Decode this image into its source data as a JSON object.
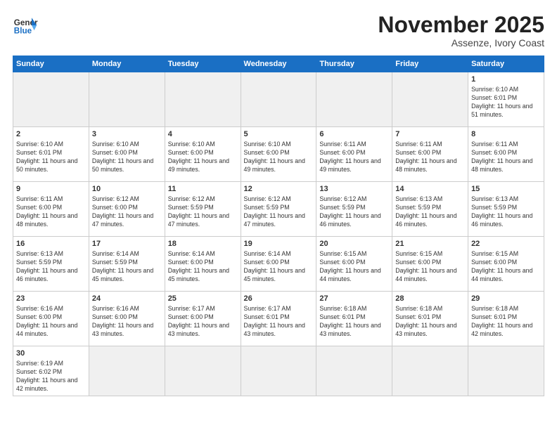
{
  "logo": {
    "text_general": "General",
    "text_blue": "Blue"
  },
  "title": "November 2025",
  "subtitle": "Assenze, Ivory Coast",
  "days_of_week": [
    "Sunday",
    "Monday",
    "Tuesday",
    "Wednesday",
    "Thursday",
    "Friday",
    "Saturday"
  ],
  "weeks": [
    [
      {
        "day": "",
        "empty": true
      },
      {
        "day": "",
        "empty": true
      },
      {
        "day": "",
        "empty": true
      },
      {
        "day": "",
        "empty": true
      },
      {
        "day": "",
        "empty": true
      },
      {
        "day": "",
        "empty": true
      },
      {
        "day": "1",
        "sunrise": "6:10 AM",
        "sunset": "6:01 PM",
        "daylight": "11 hours and 51 minutes."
      }
    ],
    [
      {
        "day": "2",
        "sunrise": "6:10 AM",
        "sunset": "6:01 PM",
        "daylight": "11 hours and 50 minutes."
      },
      {
        "day": "3",
        "sunrise": "6:10 AM",
        "sunset": "6:00 PM",
        "daylight": "11 hours and 50 minutes."
      },
      {
        "day": "4",
        "sunrise": "6:10 AM",
        "sunset": "6:00 PM",
        "daylight": "11 hours and 49 minutes."
      },
      {
        "day": "5",
        "sunrise": "6:10 AM",
        "sunset": "6:00 PM",
        "daylight": "11 hours and 49 minutes."
      },
      {
        "day": "6",
        "sunrise": "6:11 AM",
        "sunset": "6:00 PM",
        "daylight": "11 hours and 49 minutes."
      },
      {
        "day": "7",
        "sunrise": "6:11 AM",
        "sunset": "6:00 PM",
        "daylight": "11 hours and 48 minutes."
      },
      {
        "day": "8",
        "sunrise": "6:11 AM",
        "sunset": "6:00 PM",
        "daylight": "11 hours and 48 minutes."
      }
    ],
    [
      {
        "day": "9",
        "sunrise": "6:11 AM",
        "sunset": "6:00 PM",
        "daylight": "11 hours and 48 minutes."
      },
      {
        "day": "10",
        "sunrise": "6:12 AM",
        "sunset": "6:00 PM",
        "daylight": "11 hours and 47 minutes."
      },
      {
        "day": "11",
        "sunrise": "6:12 AM",
        "sunset": "5:59 PM",
        "daylight": "11 hours and 47 minutes."
      },
      {
        "day": "12",
        "sunrise": "6:12 AM",
        "sunset": "5:59 PM",
        "daylight": "11 hours and 47 minutes."
      },
      {
        "day": "13",
        "sunrise": "6:12 AM",
        "sunset": "5:59 PM",
        "daylight": "11 hours and 46 minutes."
      },
      {
        "day": "14",
        "sunrise": "6:13 AM",
        "sunset": "5:59 PM",
        "daylight": "11 hours and 46 minutes."
      },
      {
        "day": "15",
        "sunrise": "6:13 AM",
        "sunset": "5:59 PM",
        "daylight": "11 hours and 46 minutes."
      }
    ],
    [
      {
        "day": "16",
        "sunrise": "6:13 AM",
        "sunset": "5:59 PM",
        "daylight": "11 hours and 46 minutes."
      },
      {
        "day": "17",
        "sunrise": "6:14 AM",
        "sunset": "5:59 PM",
        "daylight": "11 hours and 45 minutes."
      },
      {
        "day": "18",
        "sunrise": "6:14 AM",
        "sunset": "6:00 PM",
        "daylight": "11 hours and 45 minutes."
      },
      {
        "day": "19",
        "sunrise": "6:14 AM",
        "sunset": "6:00 PM",
        "daylight": "11 hours and 45 minutes."
      },
      {
        "day": "20",
        "sunrise": "6:15 AM",
        "sunset": "6:00 PM",
        "daylight": "11 hours and 44 minutes."
      },
      {
        "day": "21",
        "sunrise": "6:15 AM",
        "sunset": "6:00 PM",
        "daylight": "11 hours and 44 minutes."
      },
      {
        "day": "22",
        "sunrise": "6:15 AM",
        "sunset": "6:00 PM",
        "daylight": "11 hours and 44 minutes."
      }
    ],
    [
      {
        "day": "23",
        "sunrise": "6:16 AM",
        "sunset": "6:00 PM",
        "daylight": "11 hours and 44 minutes."
      },
      {
        "day": "24",
        "sunrise": "6:16 AM",
        "sunset": "6:00 PM",
        "daylight": "11 hours and 43 minutes."
      },
      {
        "day": "25",
        "sunrise": "6:17 AM",
        "sunset": "6:00 PM",
        "daylight": "11 hours and 43 minutes."
      },
      {
        "day": "26",
        "sunrise": "6:17 AM",
        "sunset": "6:01 PM",
        "daylight": "11 hours and 43 minutes."
      },
      {
        "day": "27",
        "sunrise": "6:18 AM",
        "sunset": "6:01 PM",
        "daylight": "11 hours and 43 minutes."
      },
      {
        "day": "28",
        "sunrise": "6:18 AM",
        "sunset": "6:01 PM",
        "daylight": "11 hours and 43 minutes."
      },
      {
        "day": "29",
        "sunrise": "6:18 AM",
        "sunset": "6:01 PM",
        "daylight": "11 hours and 42 minutes."
      }
    ],
    [
      {
        "day": "30",
        "sunrise": "6:19 AM",
        "sunset": "6:02 PM",
        "daylight": "11 hours and 42 minutes."
      },
      {
        "day": "",
        "empty": true
      },
      {
        "day": "",
        "empty": true
      },
      {
        "day": "",
        "empty": true
      },
      {
        "day": "",
        "empty": true
      },
      {
        "day": "",
        "empty": true
      },
      {
        "day": "",
        "empty": true
      }
    ]
  ]
}
